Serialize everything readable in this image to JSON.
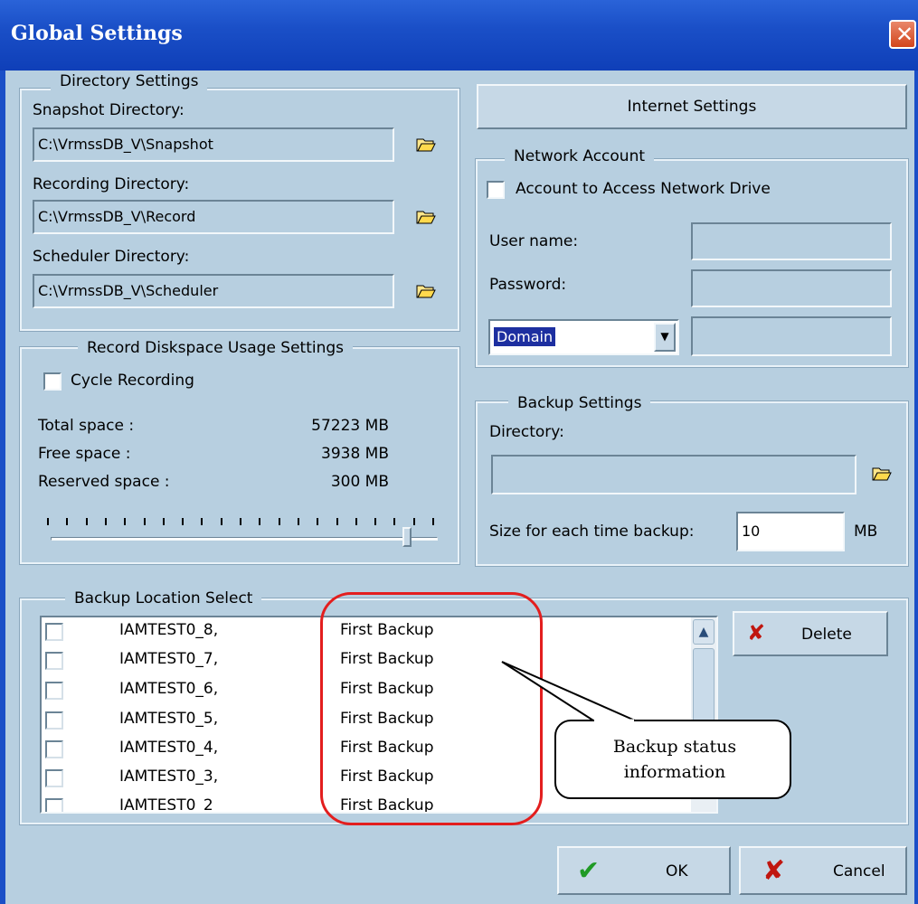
{
  "window": {
    "title": "Global Settings",
    "close_glyph": "✕"
  },
  "directory_settings": {
    "legend": "Directory Settings",
    "snapshot_label": "Snapshot Directory:",
    "snapshot_value": "C:\\VrmssDB_V\\Snapshot",
    "recording_label": "Recording Directory:",
    "recording_value": "C:\\VrmssDB_V\\Record",
    "scheduler_label": "Scheduler Directory:",
    "scheduler_value": "C:\\VrmssDB_V\\Scheduler",
    "browse_icon": "folder-open-icon"
  },
  "internet": {
    "button_label": "Internet Settings"
  },
  "network_account": {
    "legend": "Network Account",
    "checkbox_label": "Account to Access Network Drive",
    "checked": false,
    "username_label": "User name:",
    "username_value": "",
    "password_label": "Password:",
    "password_value": "",
    "domain_selected": "Domain",
    "domain_value": ""
  },
  "disk_usage": {
    "legend": "Record Diskspace Usage Settings",
    "cycle_label": "Cycle Recording",
    "cycle_checked": false,
    "total_label": "Total space :",
    "total_value": "57223 MB",
    "free_label": "Free space :",
    "free_value": "3938 MB",
    "reserved_label": "Reserved space :",
    "reserved_value": "300 MB",
    "slider_fraction": 0.92
  },
  "backup_settings": {
    "legend": "Backup Settings",
    "directory_label": "Directory:",
    "directory_value": "",
    "size_label": "Size for each time backup:",
    "size_value": "10",
    "size_unit": "MB"
  },
  "backup_location": {
    "legend": "Backup Location Select",
    "rows": [
      {
        "name": "IAMTEST0_8,",
        "status": "First Backup"
      },
      {
        "name": "IAMTEST0_7,",
        "status": "First Backup"
      },
      {
        "name": "IAMTEST0_6,",
        "status": "First Backup"
      },
      {
        "name": "IAMTEST0_5,",
        "status": "First Backup"
      },
      {
        "name": "IAMTEST0_4,",
        "status": "First Backup"
      },
      {
        "name": "IAMTEST0_3,",
        "status": "First Backup"
      },
      {
        "name": "IAMTEST0_2",
        "status": "First Backup"
      }
    ],
    "delete_label": "Delete"
  },
  "footer": {
    "ok_label": "OK",
    "cancel_label": "Cancel"
  },
  "callout": {
    "line1": "Backup status",
    "line2": "information"
  },
  "colors": {
    "title_bar": "#1a4fc7",
    "dialog_bg": "#b7cfe0",
    "highlight": "#e31e1e",
    "selection": "#1d2fa0"
  }
}
